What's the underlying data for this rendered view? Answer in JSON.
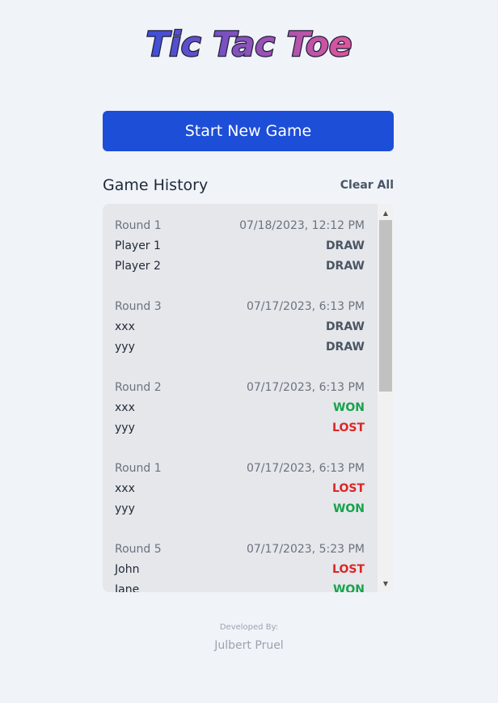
{
  "app": {
    "title": "Tic Tac Toe"
  },
  "actions": {
    "start_label": "Start New Game"
  },
  "history": {
    "title": "Game History",
    "clear_label": "Clear All",
    "rounds": [
      {
        "round": "Round 1",
        "datetime": "07/18/2023, 12:12 PM",
        "players": [
          {
            "name": "Player 1",
            "result": "DRAW"
          },
          {
            "name": "Player 2",
            "result": "DRAW"
          }
        ]
      },
      {
        "round": "Round 3",
        "datetime": "07/17/2023, 6:13 PM",
        "players": [
          {
            "name": "xxx",
            "result": "DRAW"
          },
          {
            "name": "yyy",
            "result": "DRAW"
          }
        ]
      },
      {
        "round": "Round 2",
        "datetime": "07/17/2023, 6:13 PM",
        "players": [
          {
            "name": "xxx",
            "result": "WON"
          },
          {
            "name": "yyy",
            "result": "LOST"
          }
        ]
      },
      {
        "round": "Round 1",
        "datetime": "07/17/2023, 6:13 PM",
        "players": [
          {
            "name": "xxx",
            "result": "LOST"
          },
          {
            "name": "yyy",
            "result": "WON"
          }
        ]
      },
      {
        "round": "Round 5",
        "datetime": "07/17/2023, 5:23 PM",
        "players": [
          {
            "name": "John",
            "result": "LOST"
          },
          {
            "name": "Jane",
            "result": "WON"
          }
        ]
      }
    ]
  },
  "footer": {
    "label": "Developed By:",
    "name": "Julbert Pruel"
  },
  "colors": {
    "background": "#f0f3f8",
    "primary_button": "#1d4ed8",
    "won": "#16a34a",
    "lost": "#dc2626",
    "draw": "#4b5563",
    "logo_gradient": [
      "#3b4fd8",
      "#e0559a"
    ]
  }
}
